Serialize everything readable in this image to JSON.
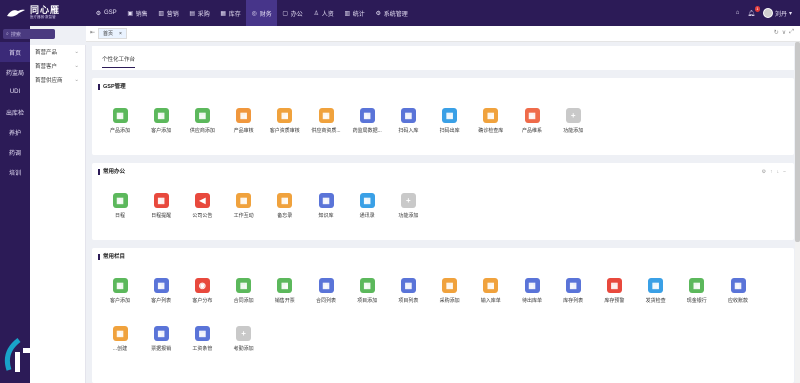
{
  "brand": {
    "title": "同心雁",
    "subtitle": "医疗器械·数智管"
  },
  "nav": [
    {
      "icon": "settings-icon",
      "label": "GSP"
    },
    {
      "icon": "cart-icon",
      "label": "销售"
    },
    {
      "icon": "chart-icon",
      "label": "营销"
    },
    {
      "icon": "bag-icon",
      "label": "采购"
    },
    {
      "icon": "box-icon",
      "label": "库存"
    },
    {
      "icon": "finance-icon",
      "label": "财务"
    },
    {
      "icon": "office-icon",
      "label": "办公"
    },
    {
      "icon": "person-icon",
      "label": "人资"
    },
    {
      "icon": "stats-icon",
      "label": "统计"
    },
    {
      "icon": "gear-icon",
      "label": "系统管理"
    }
  ],
  "user": {
    "name": "刘丹",
    "notifications": "1"
  },
  "search": {
    "placeholder": "搜索"
  },
  "sidebar": [
    "首页",
    "药监局",
    "UDI",
    "出库检",
    "养护",
    "药调",
    "培训"
  ],
  "submenu": [
    "首营产品",
    "首营客户",
    "首营供应商"
  ],
  "tabs": {
    "active": "首页"
  },
  "page_tab": "个性化工作台",
  "panels": [
    {
      "title": "GSP管理",
      "items": [
        {
          "label": "产品添加",
          "color": "#5cb85c",
          "icon": "▦"
        },
        {
          "label": "客户添加",
          "color": "#5cb85c",
          "icon": "▦"
        },
        {
          "label": "供应商添加",
          "color": "#5cb85c",
          "icon": "▦"
        },
        {
          "label": "产品审核",
          "color": "#f0973d",
          "icon": "▦"
        },
        {
          "label": "客户资质审核",
          "color": "#f0a23d",
          "icon": "▦"
        },
        {
          "label": "供应商资质...",
          "color": "#f0a23d",
          "icon": "▦"
        },
        {
          "label": "药监局数据...",
          "color": "#5a74d8",
          "icon": "▦"
        },
        {
          "label": "扫码入库",
          "color": "#5a74d8",
          "icon": "▦"
        },
        {
          "label": "扫码出库",
          "color": "#3aa0e6",
          "icon": "▦"
        },
        {
          "label": "确诊检查库",
          "color": "#f0a23d",
          "icon": "▦"
        },
        {
          "label": "产品维系",
          "color": "#ef6b4a",
          "icon": "▦"
        },
        {
          "label": "功能添加",
          "color": "#c9c9c9",
          "icon": "+"
        }
      ]
    },
    {
      "title": "常用办公",
      "items": [
        {
          "label": "日程",
          "color": "#5cb85c",
          "icon": "▦"
        },
        {
          "label": "日程提醒",
          "color": "#e8493d",
          "icon": "▦"
        },
        {
          "label": "公司公告",
          "color": "#e8493d",
          "icon": "◀"
        },
        {
          "label": "工作互动",
          "color": "#f0a23d",
          "icon": "▦"
        },
        {
          "label": "备忘录",
          "color": "#f0a23d",
          "icon": "▦"
        },
        {
          "label": "知识库",
          "color": "#5a74d8",
          "icon": "▦"
        },
        {
          "label": "通讯录",
          "color": "#3aa0e6",
          "icon": "▦"
        },
        {
          "label": "功能添加",
          "color": "#c9c9c9",
          "icon": "+"
        }
      ]
    },
    {
      "title": "常用栏目",
      "items": [
        {
          "label": "客户添加",
          "color": "#5cb85c",
          "icon": "▦"
        },
        {
          "label": "客户列表",
          "color": "#5a74d8",
          "icon": "▦"
        },
        {
          "label": "客户分布",
          "color": "#e8493d",
          "icon": "◉"
        },
        {
          "label": "合同添加",
          "color": "#5cb85c",
          "icon": "▦"
        },
        {
          "label": "销售开票",
          "color": "#5cb85c",
          "icon": "▦"
        },
        {
          "label": "合同列表",
          "color": "#5a74d8",
          "icon": "▦"
        },
        {
          "label": "项目添加",
          "color": "#5cb85c",
          "icon": "▦"
        },
        {
          "label": "项目列表",
          "color": "#5a74d8",
          "icon": "▦"
        },
        {
          "label": "采购添加",
          "color": "#f0a23d",
          "icon": "▦"
        },
        {
          "label": "输入库单",
          "color": "#f0a23d",
          "icon": "▦"
        },
        {
          "label": "待出库单",
          "color": "#5a74d8",
          "icon": "▦"
        },
        {
          "label": "库存列表",
          "color": "#5a74d8",
          "icon": "▦"
        },
        {
          "label": "库存预警",
          "color": "#e8493d",
          "icon": "▦"
        },
        {
          "label": "发货检查",
          "color": "#3aa0e6",
          "icon": "▦"
        },
        {
          "label": "现金银行",
          "color": "#5cb85c",
          "icon": "▦"
        },
        {
          "label": "应收账款",
          "color": "#5a74d8",
          "icon": "▦"
        },
        {
          "label": "...创建",
          "color": "#f0a23d",
          "icon": "▦"
        },
        {
          "label": "票据报销",
          "color": "#5a74d8",
          "icon": "▦"
        },
        {
          "label": "工资条管",
          "color": "#5a74d8",
          "icon": "▦"
        },
        {
          "label": "考勤添加",
          "color": "#c9c9c9",
          "icon": "+"
        }
      ]
    }
  ]
}
